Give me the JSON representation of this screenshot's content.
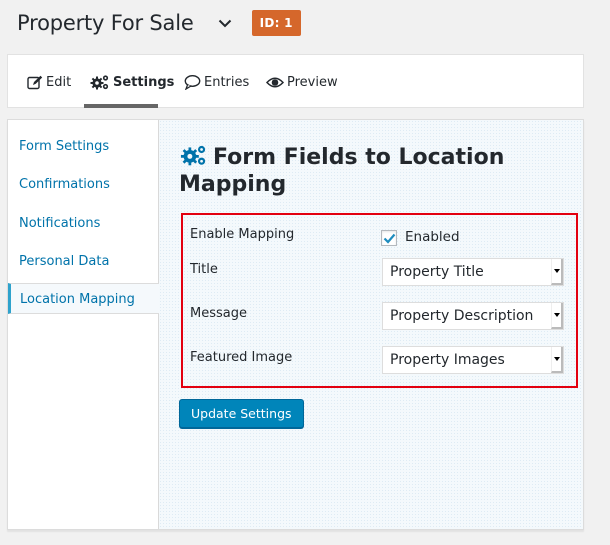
{
  "header": {
    "title": "Property For Sale",
    "id_badge": "ID: 1",
    "badge_color": "#d5672b"
  },
  "toolbar": {
    "tabs": [
      {
        "label": "Edit",
        "icon": "edit-icon",
        "active": false
      },
      {
        "label": "Settings",
        "icon": "gears-icon",
        "active": true
      },
      {
        "label": "Entries",
        "icon": "comment-icon",
        "active": false
      },
      {
        "label": "Preview",
        "icon": "eye-icon",
        "active": false
      }
    ]
  },
  "sidebar": {
    "items": [
      {
        "label": "Form Settings",
        "active": false
      },
      {
        "label": "Confirmations",
        "active": false
      },
      {
        "label": "Notifications",
        "active": false
      },
      {
        "label": "Personal Data",
        "active": false
      },
      {
        "label": "Location Mapping",
        "active": true
      }
    ]
  },
  "main": {
    "heading": "Form Fields to Location Mapping",
    "fields": {
      "enable_mapping": {
        "label": "Enable Mapping",
        "checked": true,
        "checkbox_label": "Enabled"
      },
      "title": {
        "label": "Title",
        "value": "Property Title"
      },
      "message": {
        "label": "Message",
        "value": "Property Description"
      },
      "featured_image": {
        "label": "Featured Image",
        "value": "Property Images"
      }
    },
    "submit_label": "Update Settings"
  },
  "colors": {
    "accent": "#0073aa",
    "button": "#0085ba",
    "highlight_border": "#e3000f"
  }
}
